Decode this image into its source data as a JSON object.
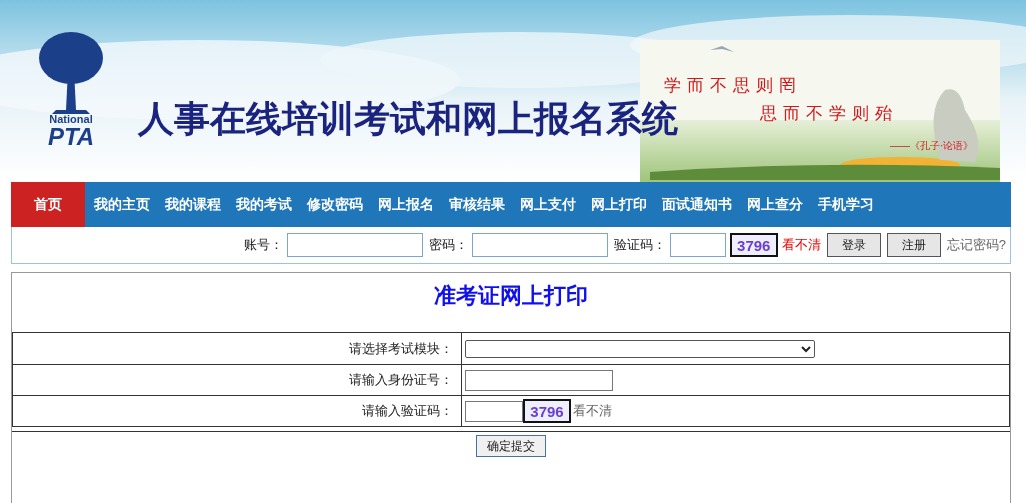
{
  "banner": {
    "logo": {
      "top": "National",
      "bottom": "PTA"
    },
    "title": "人事在线培训考试和网上报名系统",
    "quote": [
      "学而不思则罔",
      "思而不学则殆"
    ],
    "source": "——《孔子·论语》"
  },
  "nav": [
    {
      "label": "首页",
      "selected": true
    },
    {
      "label": "我的主页",
      "selected": false
    },
    {
      "label": "我的课程",
      "selected": false
    },
    {
      "label": "我的考试",
      "selected": false
    },
    {
      "label": "修改密码",
      "selected": false
    },
    {
      "label": "网上报名",
      "selected": false
    },
    {
      "label": "审核结果",
      "selected": false
    },
    {
      "label": "网上支付",
      "selected": false
    },
    {
      "label": "网上打印",
      "selected": false
    },
    {
      "label": "面试通知书",
      "selected": false
    },
    {
      "label": "网上查分",
      "selected": false
    },
    {
      "label": "手机学习",
      "selected": false
    }
  ],
  "login": {
    "fields": [
      {
        "label": "账号："
      },
      {
        "label": "密码："
      }
    ],
    "captcha_label": "验证码：",
    "captcha": "3796",
    "refresh": "看不清",
    "buttons": [
      "登录",
      "注册"
    ],
    "forgot": "忘记密码?"
  },
  "form": {
    "title": "准考证网上打印",
    "rows": [
      {
        "label": "请选择考试模块：",
        "kind": "select"
      },
      {
        "label": "请输入身份证号：",
        "kind": "text"
      },
      {
        "label": "请输入验证码：",
        "kind": "captcha",
        "captcha": "3796",
        "refresh": "看不清"
      }
    ],
    "submit": "确定提交"
  }
}
